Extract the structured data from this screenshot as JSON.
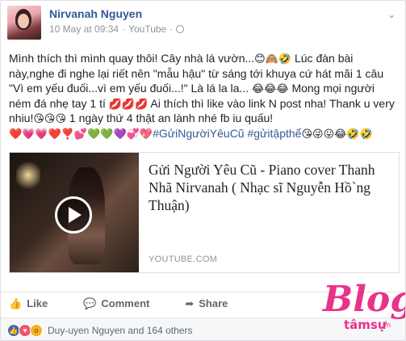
{
  "post": {
    "author": "Nirvanah Nguyen",
    "timestamp": "10 May at 09:34",
    "separator": "·",
    "source": "YouTube",
    "privacy_icon": "globe-icon",
    "menu_icon": "chevron-down-icon",
    "text_segments": [
      {
        "t": "Mình thích thì mình quay thôi! Cây nhà lá vườn..."
      },
      {
        "e": "😊🙈🤣"
      },
      {
        "t": " Lúc đàn bài này,nghe đi nghe lại riết nên \"mẫu hậu\" từ sáng tới khuya cứ hát mãi 1 câu \"Vì em yếu đuối...vì em yếu đuối...!\" Là lá la la... "
      },
      {
        "e": "😂😂😂"
      },
      {
        "t": " Mong mọi người ném đá nhẹ tay 1 tí "
      },
      {
        "e": "💋💋💋"
      },
      {
        "t": " Ai thích thì like vào link N post nha! Thank u very nhiu!"
      },
      {
        "e": "😘😘😘"
      },
      {
        "t": " 1 ngày thứ 4 thật an lành nhé fb iu quấu!"
      },
      {
        "e": "❤️💗💗❤️❣️💕💚💚💜💞💖 "
      },
      {
        "tag": "#GửiNgườiYêuCũ"
      },
      {
        "t": " "
      },
      {
        "tag": "#gửitậpthể"
      },
      {
        "e": " 😘😜😛😂🤣🤣"
      }
    ]
  },
  "link_preview": {
    "title": "Gửi Người Yêu Cũ - Piano cover Thanh Nhã Nirvanah ( Nhạc sĩ Nguyễn Hồ`ng Thuận)",
    "domain": "YOUTUBE.COM",
    "play_icon": "play-icon"
  },
  "actions": {
    "like": "Like",
    "comment": "Comment",
    "share": "Share"
  },
  "reactions": {
    "summary": "Duy-uyen Nguyen and 164 others",
    "icons": [
      "like",
      "love",
      "wow"
    ]
  },
  "watermark": {
    "big": "Blog",
    "small": "tâmsự",
    "suffix": ".vn"
  },
  "colors": {
    "link_blue": "#365899",
    "text": "#1d2129",
    "muted": "#90949c",
    "watermark_pink": "#e8338a"
  }
}
